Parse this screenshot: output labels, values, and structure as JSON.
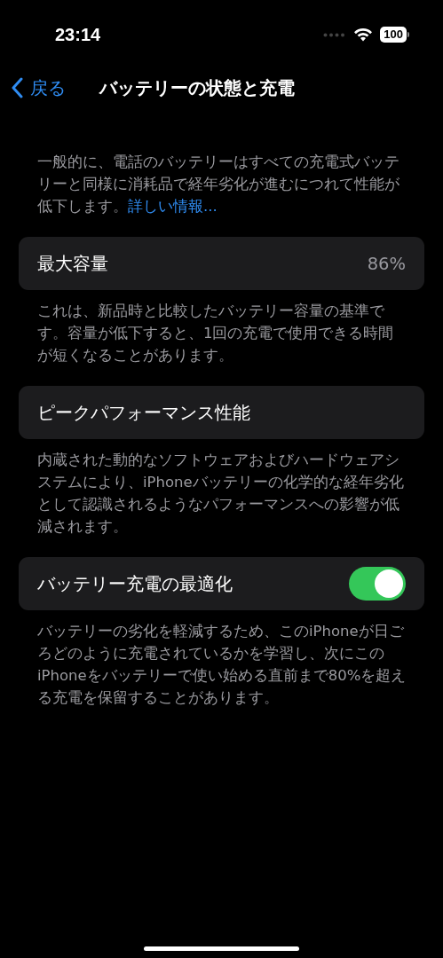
{
  "status_bar": {
    "time": "23:14",
    "battery": "100"
  },
  "nav": {
    "back": "戻る",
    "title": "バッテリーの状態と充電"
  },
  "intro": {
    "text": "一般的に、電話のバッテリーはすべての充電式バッテリーと同様に消耗品で経年劣化が進むにつれて性能が低下します。",
    "link": "詳しい情報..."
  },
  "sections": [
    {
      "kind": "value",
      "label": "最大容量",
      "value": "86%",
      "footer": "これは、新品時と比較したバッテリー容量の基準です。容量が低下すると、1回の充電で使用できる時間が短くなることがあります。"
    },
    {
      "kind": "plain",
      "label": "ピークパフォーマンス性能",
      "footer": "内蔵された動的なソフトウェアおよびハードウェアシステムにより、iPhoneバッテリーの化学的な経年劣化として認識されるようなパフォーマンスへの影響が低減されます。"
    },
    {
      "kind": "toggle",
      "label": "バッテリー充電の最適化",
      "on": true,
      "footer": "バッテリーの劣化を軽減するため、このiPhoneが日ごろどのように充電されているかを学習し、次にこのiPhoneをバッテリーで使い始める直前まで80%を超える充電を保留することがあります。"
    }
  ]
}
